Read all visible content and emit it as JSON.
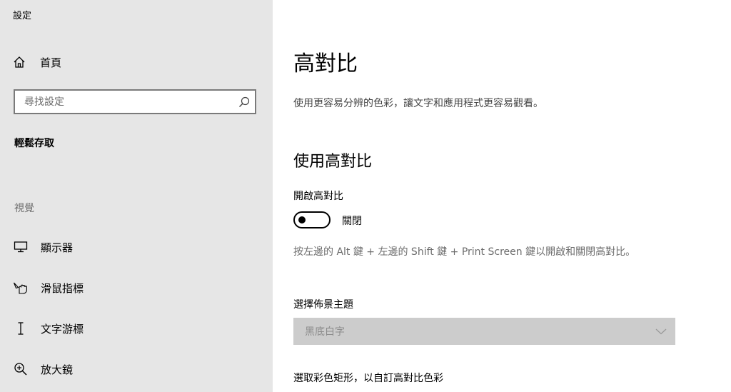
{
  "app": {
    "title": "設定"
  },
  "sidebar": {
    "home_label": "首頁",
    "search_placeholder": "尋找設定",
    "section_title": "輕鬆存取",
    "group_label": "視覺",
    "items": [
      {
        "label": "顯示器",
        "icon": "monitor-icon"
      },
      {
        "label": "滑鼠指標",
        "icon": "mouse-pointer-icon"
      },
      {
        "label": "文字游標",
        "icon": "text-cursor-icon"
      },
      {
        "label": "放大鏡",
        "icon": "magnifier-icon"
      }
    ]
  },
  "main": {
    "title": "高對比",
    "description": "使用更容易分辨的色彩，讓文字和應用程式更容易觀看。",
    "section_heading": "使用高對比",
    "toggle": {
      "label": "開啟高對比",
      "state": "關閉",
      "on": false
    },
    "hint": "按左邊的 Alt 鍵 + 左邊的 Shift 鍵 + Print Screen 鍵以開啟和關閉高對比。",
    "theme_select": {
      "label": "選擇佈景主題",
      "value": "黑底白字"
    },
    "color_label": "選取彩色矩形，以自訂高對比色彩"
  }
}
